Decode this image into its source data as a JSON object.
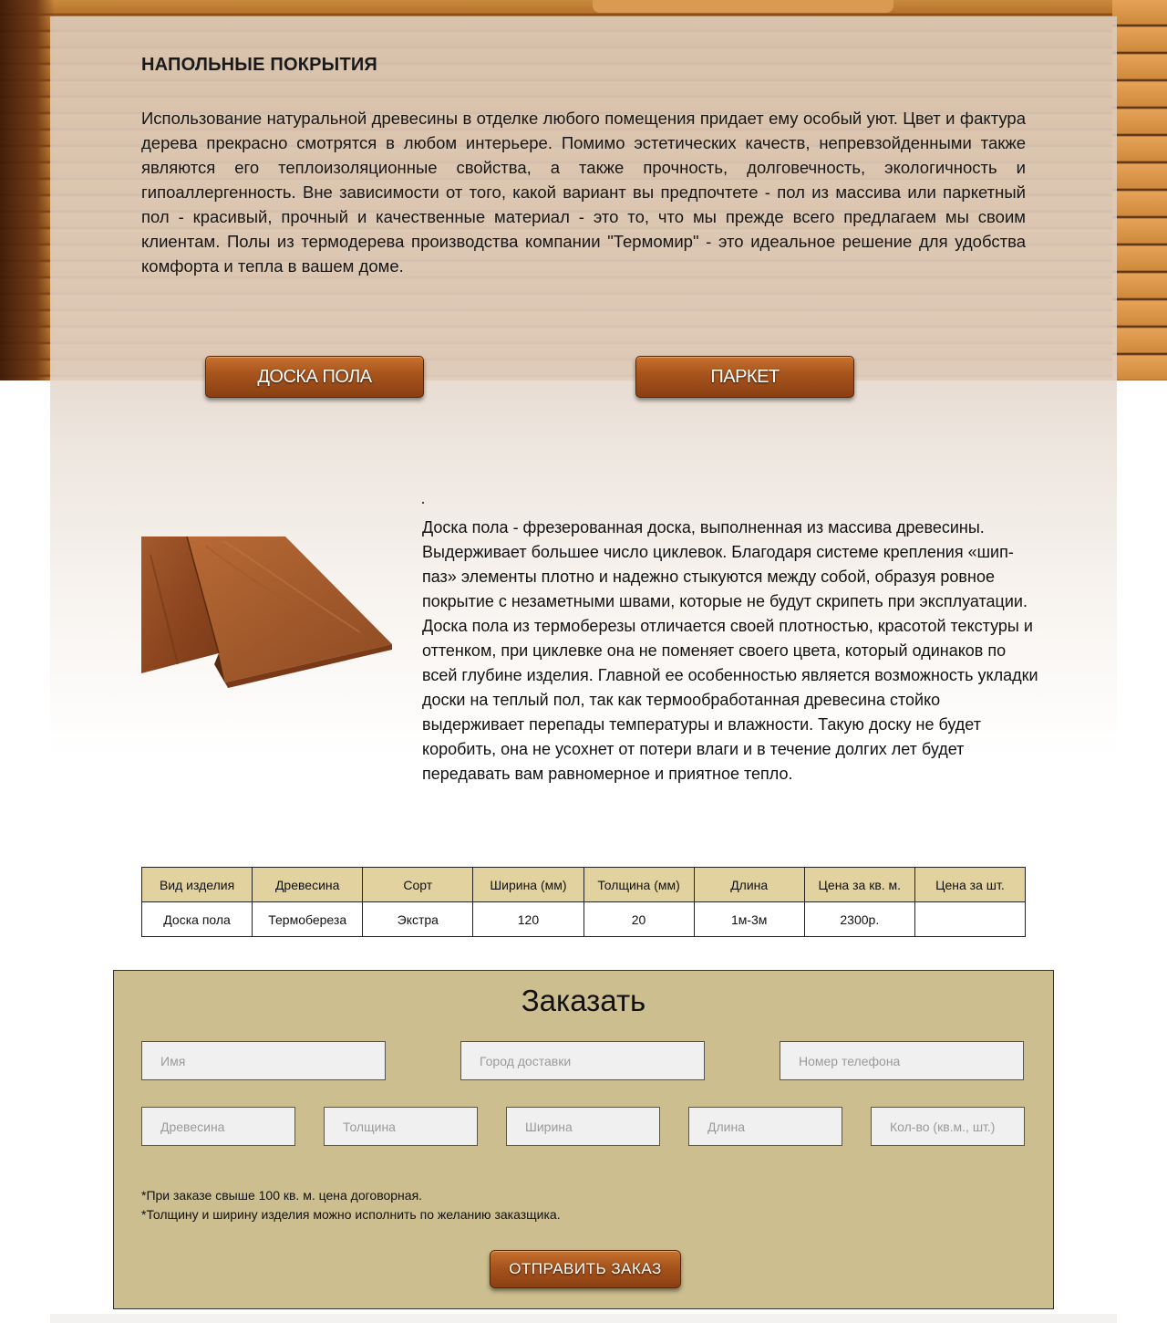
{
  "page": {
    "title": "НАПОЛЬНЫЕ ПОКРЫТИЯ",
    "intro": "Использование натуральной древесины в отделке любого помещения придает ему особый уют. Цвет и фактура дерева прекрасно смотрятся в любом интерьере. Помимо эстетических качеств, непревзойденными также являются его теплоизоляционные свойства, а также прочность, долговечность, экологичность и гипоаллергенность. Вне зависимости от того, какой вариант вы предпочтете - пол из массива или паркетный пол - красивый, прочный и качественные материал - это то, что мы прежде всего предлагаем мы своим клиентам. Полы из термодерева производства компании \"Термомир\" - это идеальное решение для удобства комфорта и тепла в вашем доме."
  },
  "category_buttons": {
    "doska": "ДОСКА ПОЛА",
    "parket": "ПАРКЕТ"
  },
  "product": {
    "paragraph1": "Доска пола -  фрезерованная доска, выполненная из массива древесины. Выдерживает  большее число циклевок. Благодаря системе крепления «шип-паз» элементы плотно и надежно стыкуются между собой, образуя ровное покрытие с незаметными швами, которые не будут скрипеть при эксплуатации.",
    "paragraph2": "Доска пола из термоберезы отличается своей плотностью, красотой текстуры и оттенком, при циклевке она не поменяет своего цвета, который одинаков по всей глубине изделия. Главной ее особенностью является возможность укладки доски на теплый пол, так как термообработанная древесина стойко выдерживает перепады температуры и влажности. Такую доску не будет коробить, она не усохнет от потери влаги и в течение долгих лет будет передавать вам равномерное и приятное тепло."
  },
  "table": {
    "headers": [
      "Вид изделия",
      "Древесина",
      "Сорт",
      "Ширина (мм)",
      "Толщина (мм)",
      "Длина",
      "Цена за кв. м.",
      "Цена за шт."
    ],
    "rows": [
      [
        "Доска пола",
        "Термобереза",
        "Экстра",
        "120",
        "20",
        "1м-3м",
        "2300р.",
        ""
      ]
    ]
  },
  "order": {
    "title": "Заказать",
    "placeholders": {
      "name": "Имя",
      "city": "Город доставки",
      "phone": "Номер телефона",
      "wood": "Древесина",
      "thickness": "Толщина",
      "width": "Ширина",
      "length": "Длина",
      "quantity": "Кол-во (кв.м., шт.)"
    },
    "notes": [
      "*При заказе свыше 100 кв. м. цена договорная.",
      "*Толщину и ширину изделия можно исполнить по желанию заказщика."
    ],
    "submit": "ОТПРАВИТЬ ЗАКАЗ"
  },
  "colors": {
    "panel_tint": "#ddcdbe",
    "table_header": "#e1d29f",
    "order_bg": "#ccbe8e",
    "wood_button": "#a9561e"
  }
}
